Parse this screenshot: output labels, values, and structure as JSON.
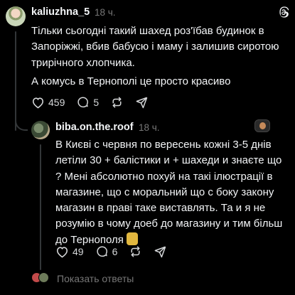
{
  "post": {
    "author": "kaliuzhna_5",
    "time": "18 ч.",
    "text_1": "Тільки сьогодні такий шахед роз'їбав будинок в Запоріжжі, вбив бабусю і маму і залишив сиротою трирічного хлопчика.",
    "text_2": "А комусь в Тернополі це просто красиво",
    "likes": "459",
    "replies": "5"
  },
  "reply": {
    "author": "biba.on.the.roof",
    "time": "18 ч.",
    "text": "В Києві с червня по вересень кожні 3-5 днів летіли 30 + балістики и + шахеди и знаєте що ? Мені абсолютно похуй на такі ілюстрації в магазине, що с моральний що с боку закону магазин в праві таке виставлять. Та и я не розумію в чому доеб до магазину и тим більш до Тернополя",
    "likes": "49",
    "replies": "6"
  },
  "show_replies": "Показать ответы",
  "icons": {
    "heart": "heart-icon",
    "comment": "comment-icon",
    "repost": "repost-icon",
    "share": "share-icon",
    "logo": "threads-logo-icon"
  }
}
